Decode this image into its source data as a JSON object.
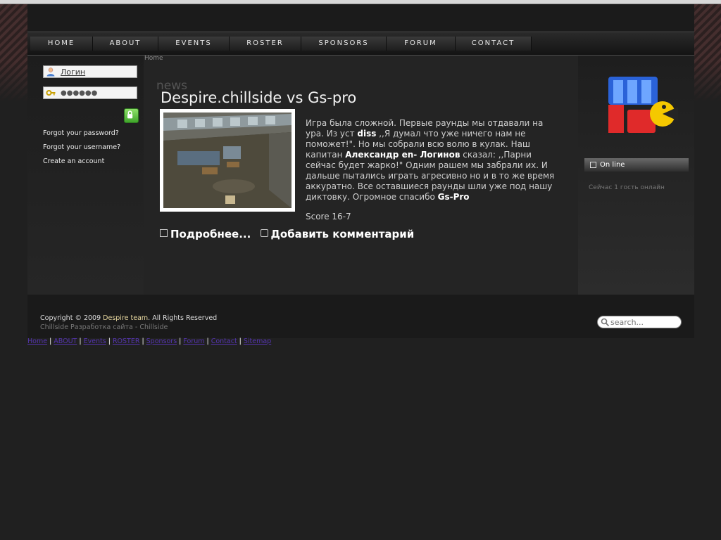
{
  "nav": {
    "items": [
      {
        "label": "HOME"
      },
      {
        "label": "ABOUT"
      },
      {
        "label": "EVENTS"
      },
      {
        "label": "ROSTER"
      },
      {
        "label": "SPONSORS"
      },
      {
        "label": "FORUM"
      },
      {
        "label": "CONTACT"
      }
    ]
  },
  "login": {
    "username_value": "Логин",
    "password_value": "●●●●●●",
    "forgot_password": "Forgot your password?",
    "forgot_username": "Forgot your username?",
    "create_account": "Create an account"
  },
  "breadcrumb": "Home",
  "news": {
    "section_label": "news",
    "title": "Despire.chillside vs Gs-pro",
    "body": [
      {
        "t": "Игра была сложной. Первые раунды мы отдавали на ура. Из уст "
      },
      {
        "b": "diss"
      },
      {
        "t": " ,,Я думал что уже ничего нам не поможет!\". Но мы собрали всю волю в кулак. Наш капитан "
      },
      {
        "b": "Александр en- Логинов"
      },
      {
        "t": " сказал: ,,Парни сейчас будет жарко!\" Одним рашем мы забрали их. И дальше пытались играть агресивно но и в то же время аккуратно. Все оставшиеся раунды шли уже под нашу диктовку. Огромное спасибо "
      },
      {
        "b": "Gs-Pro"
      }
    ],
    "score": "Score 16-7",
    "read_more": "Подробнее...",
    "add_comment": "Добавить комментарий"
  },
  "sidebar": {
    "online_title": "On line",
    "online_text": "Сейчас 1 гость онлайн"
  },
  "footer": {
    "copyright_prefix": "Copyright © 2009 ",
    "copyright_brand": "Despire team",
    "copyright_suffix": ". All Rights Reserved",
    "line2": "Chillside Разработка сайта   - Chillside",
    "search_placeholder": "search..."
  },
  "bottom_links": [
    "Home",
    "ABOUT",
    "Events",
    "ROSTER",
    "Sponsors",
    "Forum",
    "Contact",
    "Sitemap"
  ],
  "colors": {
    "background": "#202020",
    "link": "#5535b0",
    "accent_green": "#3fa52a"
  }
}
